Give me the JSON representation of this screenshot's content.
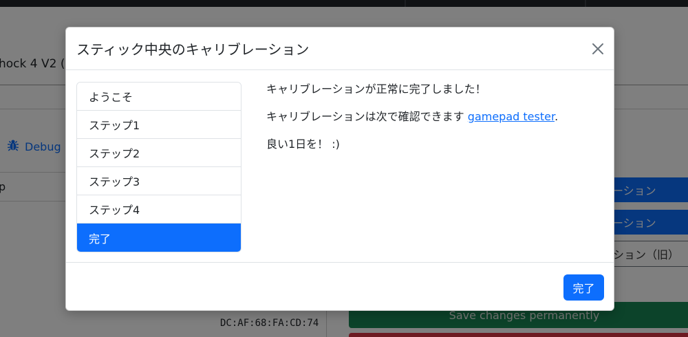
{
  "background": {
    "device_title": "hock 4 V2 (",
    "debug_label": "Debug",
    "table_cell": "p",
    "mac_address": "DC:AF:68:FA:CD:74",
    "buttons": [
      {
        "label": "ーション"
      },
      {
        "label": "ーション"
      },
      {
        "label": "ション（旧）"
      },
      {
        "label": "Save changes permanently"
      }
    ]
  },
  "modal": {
    "title": "スティック中央のキャリブレーション",
    "close_icon": "close-icon",
    "steps": [
      {
        "label": "ようこそ",
        "active": false
      },
      {
        "label": "ステップ1",
        "active": false
      },
      {
        "label": "ステップ2",
        "active": false
      },
      {
        "label": "ステップ3",
        "active": false
      },
      {
        "label": "ステップ4",
        "active": false
      },
      {
        "label": "完了",
        "active": true
      }
    ],
    "content": {
      "line1": "キャリブレーションが正常に完了しました！",
      "line2_prefix": "キャリブレーションは次で確認できます ",
      "line2_link": "gamepad tester",
      "line2_suffix": ".",
      "line3": "良い1日を！ :)"
    },
    "done_button": "完了"
  },
  "colors": {
    "primary": "#0d6efd",
    "success": "#198754",
    "danger": "#dc3545"
  }
}
